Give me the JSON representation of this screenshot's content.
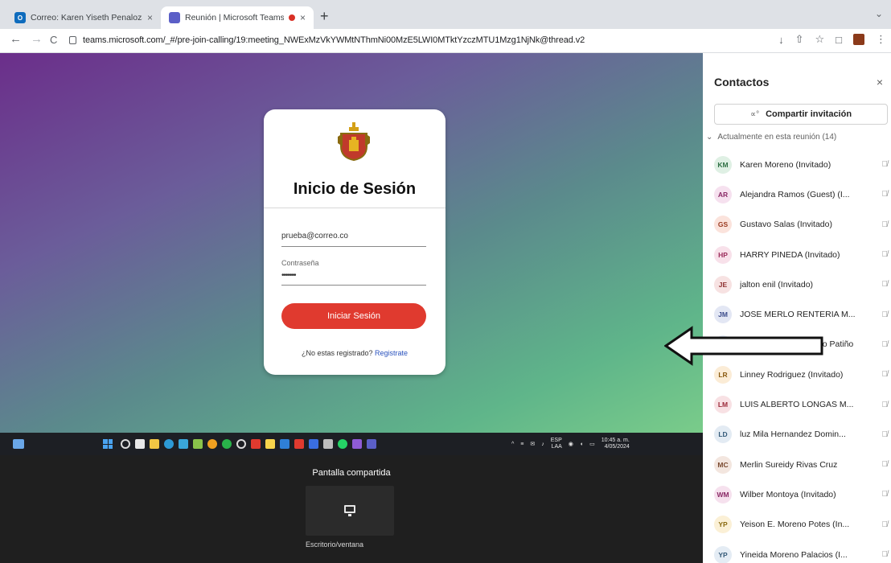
{
  "browser": {
    "tabs": [
      {
        "title": "Correo: Karen Yiseth Penaloza",
        "close": "×",
        "favicon": "outlook-icon",
        "active": false
      },
      {
        "title": "Reunión | Microsoft Teams",
        "close": "×",
        "favicon": "teams-icon",
        "active": true,
        "recording": true
      }
    ],
    "new_tab": "+",
    "tab_menu": "⌄",
    "nav": {
      "back": "←",
      "forward": "→",
      "reload": "C"
    },
    "url": "teams.microsoft.com/_#/pre-join-calling/19:meeting_NWExMzVkYWMtNThmNi00MzE5LWI0MTktYzczMTU1Mzg1NjNk@thread.v2",
    "toolbar_icons": {
      "download": "↓",
      "share": "⇧",
      "bookmark": "☆",
      "sidepanel": "□",
      "menu": "⋮"
    }
  },
  "shared_screen": {
    "login": {
      "title": "Inicio de Sesión",
      "email_value": "prueba@correo.co",
      "password_label": "Contraseña",
      "password_value": "•••••••",
      "login_button": "Iniciar Sesión",
      "register_prompt": "¿No estas registrado?",
      "register_link": "Registrate"
    },
    "taskbar": {
      "lang_top": "ESP",
      "lang_bottom": "LAA",
      "time": "10:45 a. m.",
      "date": "4/05/2024"
    }
  },
  "stage": {
    "title": "Pantalla compartida",
    "tile_caption": "Escritorio/ventana"
  },
  "contacts_panel": {
    "title": "Contactos",
    "close": "×",
    "invite_button": "Compartir invitación",
    "invite_icon": "share-icon",
    "section_toggle": "⌄",
    "section_label": "Actualmente en esta reunión (14)",
    "mic_off": "🎙̸",
    "participants": [
      {
        "initials": "KM",
        "name": "Karen Moreno (Invitado)",
        "avatar_bg": "#dff0e4",
        "avatar_fg": "#2e6f44"
      },
      {
        "initials": "AR",
        "name": "Alejandra Ramos (Guest) (I...",
        "avatar_bg": "#f6e1ef",
        "avatar_fg": "#8a2a66"
      },
      {
        "initials": "GS",
        "name": "Gustavo Salas (Invitado)",
        "avatar_bg": "#fbe3dc",
        "avatar_fg": "#9a3a20"
      },
      {
        "initials": "HP",
        "name": "HARRY PINEDA (Invitado)",
        "avatar_bg": "#f8e1ea",
        "avatar_fg": "#9b2c5b"
      },
      {
        "initials": "JE",
        "name": "jalton enil (Invitado)",
        "avatar_bg": "#f7e2e2",
        "avatar_fg": "#8e2f2f"
      },
      {
        "initials": "JM",
        "name": "JOSE MERLO RENTERIA M...",
        "avatar_bg": "#e3e7f4",
        "avatar_fg": "#3a4a8a"
      },
      {
        "initials": "JC",
        "name": "Juan Carlos Bonoencio Patiño",
        "avatar_bg": "#e4ecf7",
        "avatar_fg": "#2f5a8a"
      },
      {
        "initials": "LR",
        "name": "Linney Rodriguez (Invitado)",
        "avatar_bg": "#fbecd6",
        "avatar_fg": "#8a5a10"
      },
      {
        "initials": "LM",
        "name": "LUIS ALBERTO LONGAS M...",
        "avatar_bg": "#f8e1e4",
        "avatar_fg": "#9b2a3a"
      },
      {
        "initials": "LD",
        "name": "luz Mila Hernandez Domin...",
        "avatar_bg": "#e3ebf3",
        "avatar_fg": "#345a78"
      },
      {
        "initials": "MC",
        "name": "Merlin Sureidy Rivas Cruz",
        "avatar_bg": "#f3e6df",
        "avatar_fg": "#7a4a30"
      },
      {
        "initials": "WM",
        "name": "Wilber Montoya (Invitado)",
        "avatar_bg": "#f6e1ee",
        "avatar_fg": "#8a2a66"
      },
      {
        "initials": "YP",
        "name": "Yeison E. Moreno Potes (In...",
        "avatar_bg": "#fbf0d6",
        "avatar_fg": "#8a6a10"
      },
      {
        "initials": "YP",
        "name": "Yineida Moreno Palacios (I...",
        "avatar_bg": "#e4ecf4",
        "avatar_fg": "#345a78"
      }
    ]
  }
}
